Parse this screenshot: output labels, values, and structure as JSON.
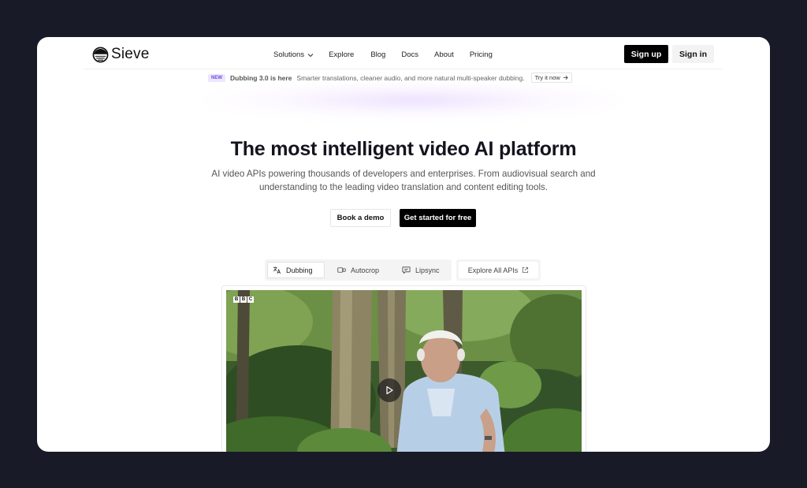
{
  "brand": {
    "name": "Sieve"
  },
  "nav": {
    "items": [
      {
        "label": "Solutions",
        "has_dropdown": true
      },
      {
        "label": "Explore"
      },
      {
        "label": "Blog"
      },
      {
        "label": "Docs"
      },
      {
        "label": "About"
      },
      {
        "label": "Pricing"
      }
    ],
    "signup_label": "Sign up",
    "signin_label": "Sign in"
  },
  "announcement": {
    "badge": "NEW",
    "title": "Dubbing 3.0 is here",
    "text": "Smarter translations, cleaner audio, and more natural multi-speaker dubbing.",
    "cta": "Try it now"
  },
  "hero": {
    "title": "The most intelligent video AI platform",
    "subtitle_line1": "AI video APIs powering thousands of developers and enterprises. From audiovisual search and",
    "subtitle_line2": "understanding to the leading video translation and content editing tools.",
    "demo_label": "Book a demo",
    "start_label": "Get started for free"
  },
  "tabs": [
    {
      "label": "Dubbing",
      "icon": "translate-icon",
      "active": true
    },
    {
      "label": "Autocrop",
      "icon": "crop-icon",
      "active": false
    },
    {
      "label": "Lipsync",
      "icon": "speech-bubble-icon",
      "active": false
    }
  ],
  "explore_apis": {
    "label": "Explore All APIs",
    "icon": "external-link-icon"
  },
  "video": {
    "watermark": [
      "B",
      "B",
      "C"
    ],
    "icon": "play-icon"
  },
  "colors": {
    "page_background": "#181a28",
    "primary_button": "#000000",
    "badge_purple": "#6d4bd8"
  }
}
